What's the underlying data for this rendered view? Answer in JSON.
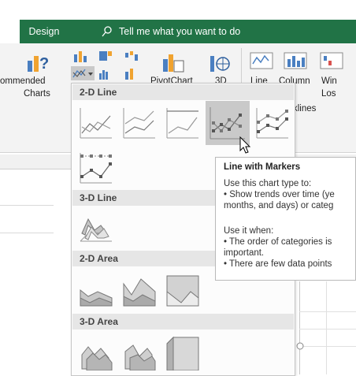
{
  "menu": {
    "design_label": "Design",
    "tellme_text": "Tell me what you want to do"
  },
  "ribbon": {
    "recommended_line1": "ommended",
    "recommended_line2": "Charts",
    "pivotchart_label": "PivotChart",
    "map3d_label": "3D",
    "line_label": "Line",
    "column_label": "Column",
    "winloss_line1": "Win",
    "winloss_line2": "Los",
    "sparklines_label": "klines"
  },
  "dropdown": {
    "sections": {
      "line2d": "2-D Line",
      "line3d": "3-D Line",
      "area2d": "2-D Area",
      "area3d": "3-D Area"
    }
  },
  "tooltip": {
    "title": "Line with Markers",
    "lines": [
      "Use this chart type to:",
      "• Show trends over time (ye",
      "months, and days) or categ",
      "",
      "Use it when:",
      "• The order of categories is",
      "important.",
      "• There are few data points"
    ]
  },
  "colors": {
    "excel_green": "#217346",
    "hover_gray": "#c9c9c9"
  }
}
